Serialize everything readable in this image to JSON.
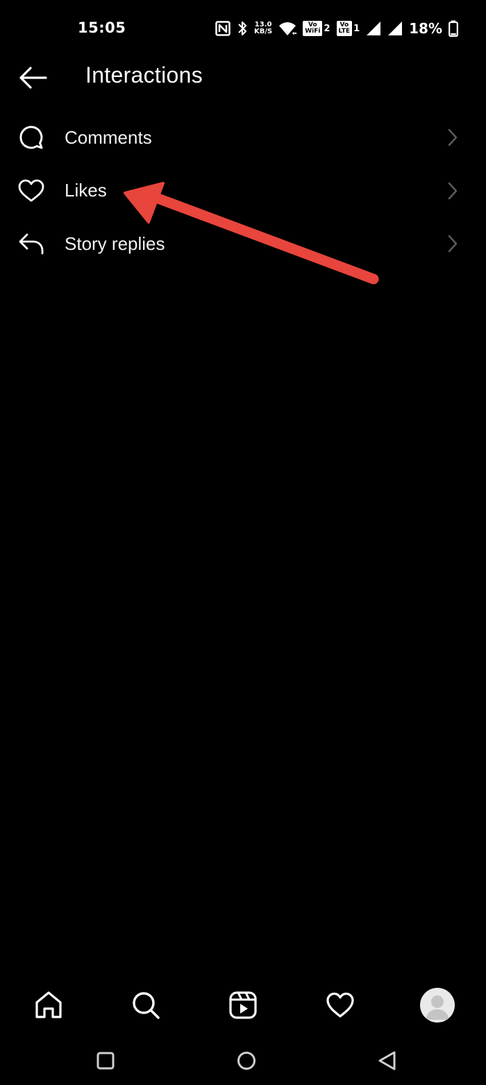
{
  "status_bar": {
    "time": "15:05",
    "nfc_icon": "N",
    "net_speed_value": "13.0",
    "net_speed_unit": "KB/S",
    "volte1_top": "Vo",
    "volte1_bottom": "WiFi",
    "volte1_num": "2",
    "volte2_top": "Vo",
    "volte2_bottom": "LTE",
    "volte2_num": "1",
    "battery_percent": "18%"
  },
  "header": {
    "title": "Interactions"
  },
  "menu": {
    "items": [
      {
        "label": "Comments",
        "icon": "comment-icon"
      },
      {
        "label": "Likes",
        "icon": "heart-icon"
      },
      {
        "label": "Story replies",
        "icon": "reply-icon"
      }
    ]
  },
  "annotation": {
    "arrow_color": "#e8453c"
  },
  "bottom_nav": {
    "items": [
      "home-icon",
      "search-icon",
      "reels-icon",
      "heart-icon",
      "profile-avatar"
    ]
  },
  "system_nav": {
    "items": [
      "recents-button",
      "home-button",
      "back-button"
    ]
  }
}
